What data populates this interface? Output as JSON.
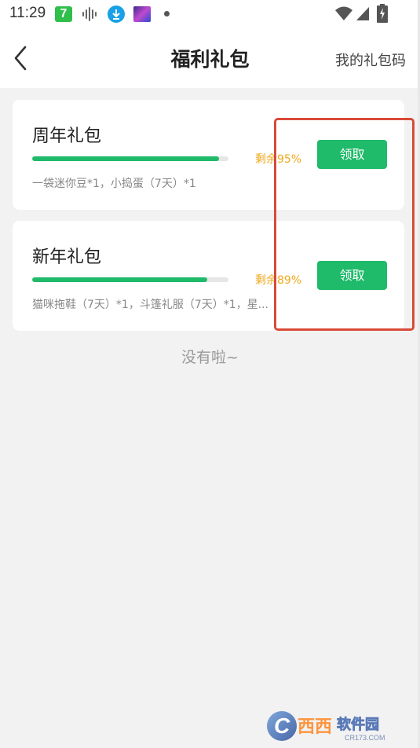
{
  "status_bar": {
    "time": "11:29",
    "app_badge": "7",
    "icons": [
      "app7-icon",
      "soundwave-icon",
      "download-icon",
      "game-thumbnail-icon",
      "dot-icon",
      "wifi-icon",
      "signal-icon",
      "battery-icon"
    ]
  },
  "header": {
    "title": "福利礼包",
    "right_link": "我的礼包码"
  },
  "gifts": [
    {
      "name": "周年礼包",
      "remaining_percent": 95,
      "remaining_label": "剩余95%",
      "items": "一袋迷你豆*1，小捣蛋（7天）*1",
      "button_label": "领取"
    },
    {
      "name": "新年礼包",
      "remaining_percent": 89,
      "remaining_label": "剩余89%",
      "items": "猫咪拖鞋（7天）*1，斗篷礼服（7天）*1，星...",
      "button_label": "领取"
    }
  ],
  "end_text": "没有啦~",
  "colors": {
    "accent_green": "#1fba6a",
    "remaining_orange": "#f0a71a",
    "highlight_red": "#d94a38",
    "background": "#f2f2f2"
  },
  "watermark": {
    "brand": "西西软件园",
    "domain": "CR173.COM"
  }
}
